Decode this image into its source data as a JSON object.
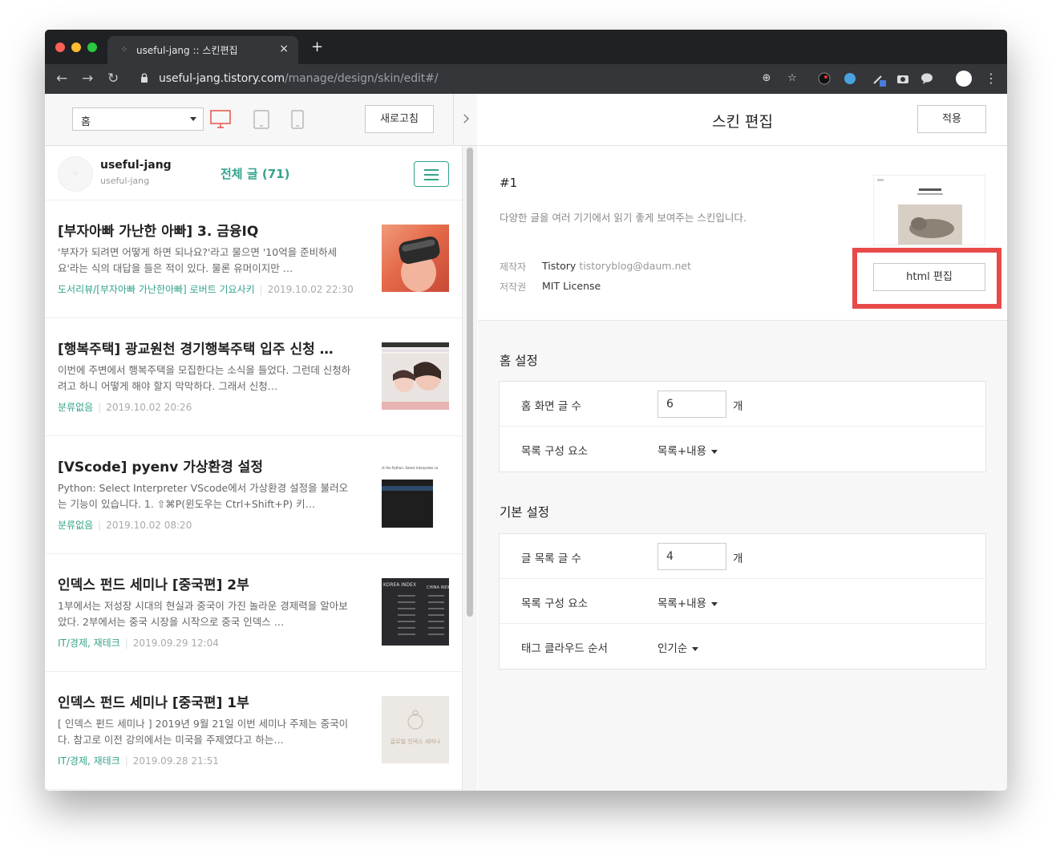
{
  "browser": {
    "tab_title": "useful-jang :: 스킨편집",
    "tab_close": "×",
    "new_tab": "+",
    "url_host": "useful-jang.tistory.com",
    "url_path": "/manage/design/skin/edit#/"
  },
  "left_panel": {
    "page_select_value": "홈",
    "refresh_label": "새로고침",
    "blog_name": "useful-jang",
    "blog_id": "useful-jang",
    "all_posts_label": "전체 글 (71)",
    "posts": [
      {
        "title": "[부자아빠 가난한 아빠] 3. 금융IQ",
        "summary": "'부자가 되려면 어떻게 하면 되나요?'라고 물으면 '10억을 준비하세요'라는 식의 대답을 들은 적이 있다. 물론 유머이지만 …",
        "category": "도서리뷰/[부자아빠 가난한아빠] 로버트 기요사키",
        "date": "2019.10.02 22:30"
      },
      {
        "title": "[행복주택] 광교원천 경기행복주택 입주 신청 …",
        "summary": "이번에 주변에서 행복주택을 모집한다는 소식을 들었다. 그런데 신청하려고 하니 어떻게 해야 할지 막막하다. 그래서 신청…",
        "category": "분류없음",
        "date": "2019.10.02 20:26"
      },
      {
        "title": "[VScode] pyenv 가상환경 설정",
        "summary": "Python: Select Interpreter VScode에서 가상환경 설정을 불러오는 기능이 있습니다. 1. ⇧⌘P(윈도우는 Ctrl+Shift+P) 키…",
        "category": "분류없음",
        "date": "2019.10.02 08:20"
      },
      {
        "title": "인덱스 펀드 세미나 [중국편] 2부",
        "summary": "1부에서는 저성장 시대의 현실과 중국이 가진 놀라운 경제력을 알아보았다. 2부에서는 중국 시장을 시작으로 중국 인덱스 …",
        "category": "IT/경제, 재테크",
        "date": "2019.09.29 12:04"
      },
      {
        "title": "인덱스 펀드 세미나 [중국편] 1부",
        "summary": "[ 인덱스 펀드 세미나 ] 2019년 9월 21일 이번 세미나 주제는 중국이다. 참고로 이전 강의에서는 미국을 주제였다고 하는…",
        "category": "IT/경제, 재테크",
        "date": "2019.09.28 21:51"
      }
    ],
    "thumb_texts": {
      "vscode": "ct the Python: Select Interpreter co",
      "korea_index": "KOREA INDEX",
      "china_index": "CHINA INDE",
      "seminar": "글로벌 인덱스 세미나"
    }
  },
  "right_panel": {
    "title": "스킨 편집",
    "apply_label": "적용",
    "skin_number": "#1",
    "skin_description": "다양한 글을 여러 기기에서 읽기 좋게 보여주는 스킨입니다.",
    "maker_label": "제작자",
    "maker_name": "Tistory",
    "maker_email": "tistoryblog@daum.net",
    "license_label": "저작권",
    "license_value": "MIT License",
    "html_edit_label": "html 편집",
    "home_settings": {
      "title": "홈 설정",
      "post_count_label": "홈 화면 글 수",
      "post_count_value": "6",
      "unit": "개",
      "list_items_label": "목록 구성 요소",
      "list_items_value": "목록+내용"
    },
    "basic_settings": {
      "title": "기본 설정",
      "post_count_label": "글 목록 글 수",
      "post_count_value": "4",
      "unit": "개",
      "list_items_label": "목록 구성 요소",
      "list_items_value": "목록+내용",
      "tag_order_label": "태그 클라우드 순서",
      "tag_order_value": "인기순"
    }
  },
  "colors": {
    "accent": "#34a38b",
    "highlight": "#e84a4a",
    "chrome_dark": "#202124"
  }
}
